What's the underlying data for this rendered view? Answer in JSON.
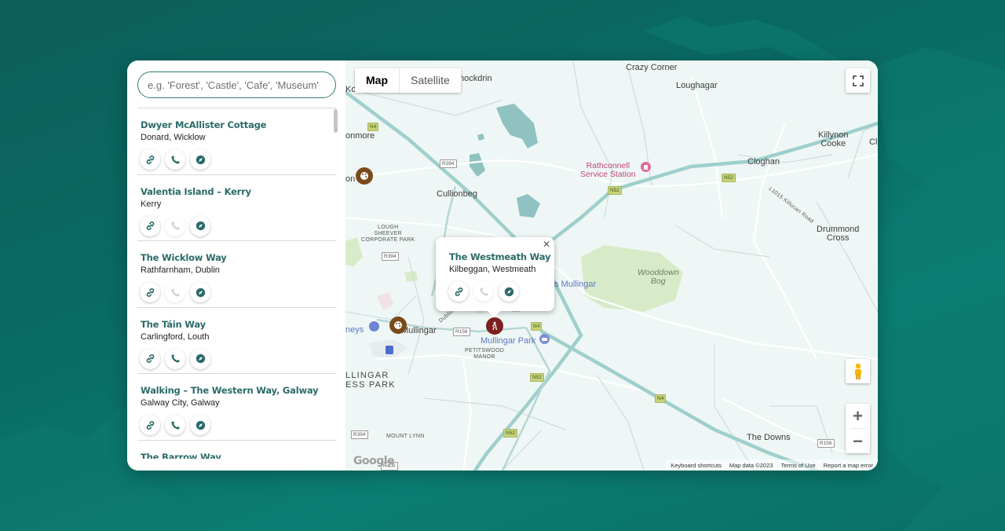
{
  "search": {
    "placeholder": "e.g. 'Forest', 'Castle', 'Cafe', 'Museum'"
  },
  "listings": [
    {
      "title": "Dwyer McAllister Cottage",
      "location": "Donard, Wicklow",
      "phone_enabled": true
    },
    {
      "title": "Valentia Island – Kerry",
      "location": "Kerry",
      "phone_enabled": false
    },
    {
      "title": "The Wicklow Way",
      "location": "Rathfarnham, Dublin",
      "phone_enabled": false
    },
    {
      "title": "The Táin Way",
      "location": "Carlingford, Louth",
      "phone_enabled": true
    },
    {
      "title": "Walking – The Western Way, Galway",
      "location": "Galway City, Galway",
      "phone_enabled": true
    },
    {
      "title": "The Barrow Way",
      "location": "",
      "phone_enabled": true
    }
  ],
  "map": {
    "type_buttons": {
      "map": "Map",
      "satellite": "Satellite"
    },
    "popup": {
      "title": "The Westmeath Way",
      "location": "Kilbeggan, Westmeath",
      "phone_enabled": false
    },
    "labels": {
      "crazy_corner": "Crazy Corner",
      "loughagar": "Loughagar",
      "killynon_cooke": "Killynon\nCooke",
      "cl": "Cl",
      "nockdrin": "nockdrin",
      "kor": "Kor",
      "onmore": "onmore",
      "rathconnell": "Rathconnell\nService Station",
      "cloghan": "Cloghan",
      "killucan_road": "L1015 Killucan Road",
      "cullionbeg": "Cullionbeg",
      "drummond_cross": "Drummond\nCross",
      "lough_sheever": "LOUGH\nSHEEVER\nCORPORATE PARK",
      "wooddown_bog": "Wooddown\nBog",
      "s_mullingar": "s Mullingar",
      "mullingar": "Mullingar",
      "neys": "neys",
      "mullingar_park": "Mullingar Park",
      "petitswood": "PETITSWOOD\nMANOR",
      "mullingar_business": "LLINGAR\nESS PARK",
      "mount_lynn": "MOUNT LYNN",
      "the_downs": "The Downs",
      "dublin_rd": "Dublin Rd",
      "rk": "RK",
      "on": "on"
    },
    "shields": {
      "n4_top": "N4",
      "r394_a": "R394",
      "r394_b": "R394",
      "r394_c": "R394",
      "n52_a": "N52",
      "n52_b": "N52",
      "n52_c": "N52",
      "n52_d": "N52",
      "n4_mid": "N4",
      "n4_right": "N4",
      "r156_a": "R156",
      "r156_b": "R156",
      "r400": "R400"
    },
    "footer": {
      "shortcuts": "Keyboard shortcuts",
      "data": "Map data ©2023",
      "terms": "Terms of Use",
      "report": "Report a map error"
    },
    "logo": "Google",
    "zoom_in": "+",
    "zoom_out": "−"
  },
  "colors": {
    "accent": "#2b6b6a",
    "poi_marker": "#7a4b1a",
    "trail_marker": "#7d1f1f",
    "road": "#9fcfcc"
  }
}
